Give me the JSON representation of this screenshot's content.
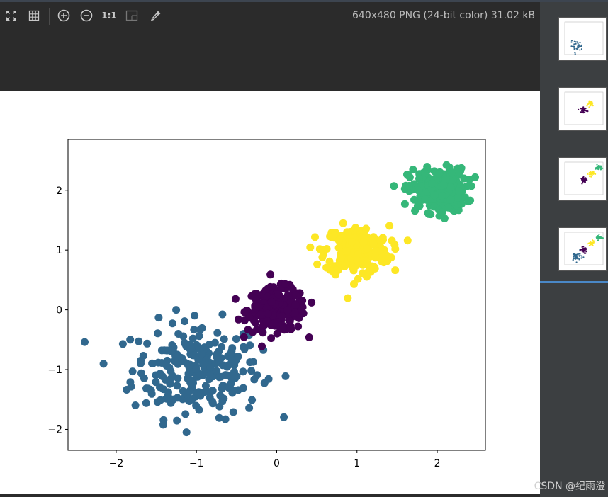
{
  "toolbar": {
    "buttons": [
      {
        "icon": "fit-to-window-icon"
      },
      {
        "icon": "grid-icon"
      },
      {
        "icon": "zoom-in-icon"
      },
      {
        "icon": "zoom-out-icon"
      },
      {
        "icon": "actual-size-icon",
        "label": "1:1"
      },
      {
        "icon": "chessboard-icon"
      },
      {
        "icon": "color-picker-icon"
      }
    ],
    "image_info": "640x480 PNG (24-bit color) 31.02 kB"
  },
  "watermark": "CSDN @纪雨澄",
  "colors": {
    "cluster_purple": "#440154",
    "cluster_blue": "#31688e",
    "cluster_green": "#35b779",
    "cluster_yellow": "#fde725"
  },
  "thumbnails": [
    {
      "name": "thumbnail-1",
      "clusters": [
        "blue"
      ]
    },
    {
      "name": "thumbnail-2",
      "clusters": [
        "yellow",
        "purple"
      ]
    },
    {
      "name": "thumbnail-3",
      "clusters": [
        "purple",
        "yellow",
        "green"
      ]
    },
    {
      "name": "thumbnail-4",
      "clusters": [
        "blue",
        "purple",
        "yellow",
        "green"
      ]
    }
  ],
  "chart_data": {
    "type": "scatter",
    "title": "",
    "xlabel": "",
    "ylabel": "",
    "xlim": [
      -2.6,
      2.6
    ],
    "ylim": [
      -2.35,
      2.85
    ],
    "xticks": [
      "−2",
      "−1",
      "0",
      "1",
      "2"
    ],
    "yticks": [
      "2",
      "1",
      "0",
      "−1",
      "−2"
    ],
    "grid": false,
    "series": [
      {
        "color": "#440154",
        "center": [
          0,
          0
        ],
        "spread": 0.18,
        "count": 250
      },
      {
        "color": "#31688e",
        "center": [
          -1,
          -1
        ],
        "spread": 0.4,
        "count": 250
      },
      {
        "color": "#fde725",
        "center": [
          1,
          1
        ],
        "spread": 0.2,
        "count": 250
      },
      {
        "color": "#35b779",
        "center": [
          2,
          2
        ],
        "spread": 0.18,
        "count": 250
      }
    ]
  }
}
